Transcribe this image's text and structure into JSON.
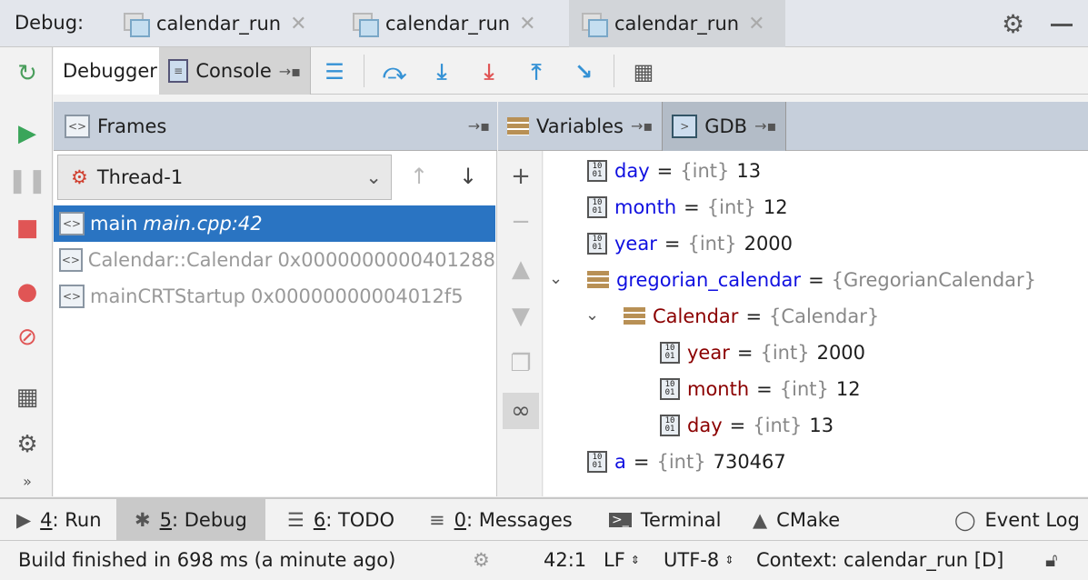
{
  "debug_label": "Debug:",
  "run_tabs": [
    {
      "label": "calendar_run"
    },
    {
      "label": "calendar_run"
    },
    {
      "label": "calendar_run"
    }
  ],
  "toolbar": {
    "debugger_tab": "Debugger",
    "console_tab": "Console"
  },
  "frames": {
    "title": "Frames",
    "thread": "Thread-1",
    "items": [
      {
        "name": "main",
        "loc": "main.cpp:42"
      },
      {
        "name": "Calendar::Calendar",
        "loc": "0x0000000000401288"
      },
      {
        "name": "mainCRTStartup",
        "loc": "0x00000000004012f5"
      }
    ]
  },
  "variables": {
    "title": "Variables",
    "gdb_tab": "GDB",
    "rows": [
      {
        "name": "day",
        "eq": "=",
        "type": "{int}",
        "value": "13"
      },
      {
        "name": "month",
        "eq": "=",
        "type": "{int}",
        "value": "12"
      },
      {
        "name": "year",
        "eq": "=",
        "type": "{int}",
        "value": "2000"
      },
      {
        "name": "gregorian_calendar",
        "eq": "=",
        "type": "{GregorianCalendar}",
        "value": ""
      },
      {
        "name": "Calendar",
        "eq": "=",
        "type": "{Calendar}",
        "value": ""
      },
      {
        "name": "year",
        "eq": "=",
        "type": "{int}",
        "value": "2000"
      },
      {
        "name": "month",
        "eq": "=",
        "type": "{int}",
        "value": "12"
      },
      {
        "name": "day",
        "eq": "=",
        "type": "{int}",
        "value": "13"
      },
      {
        "name": "a",
        "eq": "=",
        "type": "{int}",
        "value": "730467"
      }
    ]
  },
  "bottom_tabs": {
    "run_key": "4",
    "run": ": Run",
    "debug_key": "5",
    "debug": ": Debug",
    "todo_key": "6",
    "todo": ": TODO",
    "msg_key": "0",
    "msg": ": Messages",
    "terminal": "Terminal",
    "cmake": "CMake",
    "event_log": "Event Log"
  },
  "status": {
    "message": "Build finished in 698 ms (a minute ago)",
    "position": "42:1",
    "line_sep": "LF",
    "encoding": "UTF-8",
    "context": "Context: calendar_run [D]"
  }
}
